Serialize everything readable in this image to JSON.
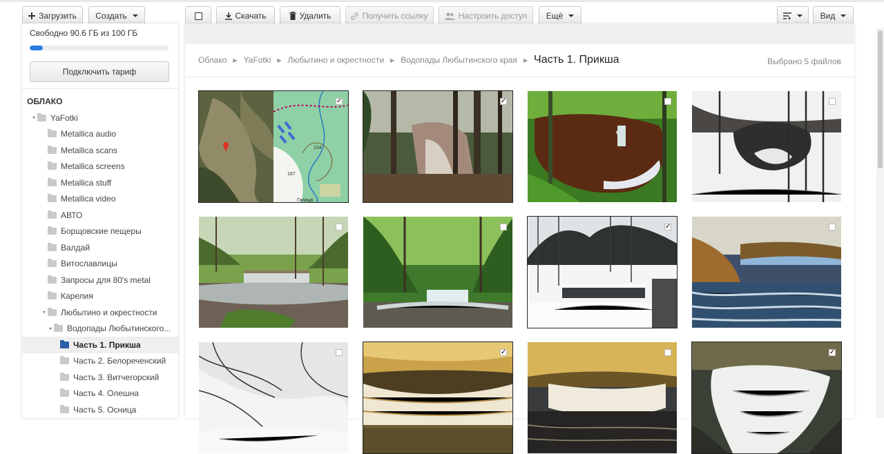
{
  "toolbar": {
    "upload": "Загрузить",
    "create": "Создать",
    "download": "Скачать",
    "delete": "Удалить",
    "get_link": "Получить ссылку",
    "share": "Настроить доступ",
    "more": "Ещё",
    "view": "Вид"
  },
  "sidebar": {
    "quota_text": "Свободно 90.6 ГБ из 100 ГБ",
    "quota_used": 0.094,
    "plan_button": "Подключить тариф",
    "section": "ОБЛАКО",
    "tree": [
      {
        "label": "YaFotki",
        "level": 0,
        "toggle": "▾"
      },
      {
        "label": "Metallica audio",
        "level": 1
      },
      {
        "label": "Metallica scans",
        "level": 1
      },
      {
        "label": "Metallica screens",
        "level": 1
      },
      {
        "label": "Metallica stuff",
        "level": 1
      },
      {
        "label": "Metallica video",
        "level": 1
      },
      {
        "label": "АВТО",
        "level": 1
      },
      {
        "label": "Борщовские пещеры",
        "level": 1
      },
      {
        "label": "Валдай",
        "level": 1
      },
      {
        "label": "Витославлицы",
        "level": 1
      },
      {
        "label": "Запросы для 80's metal",
        "level": 1
      },
      {
        "label": "Карелия",
        "level": 1
      },
      {
        "label": "Любытино и окрестности",
        "level": 1,
        "toggle": "▾"
      },
      {
        "label": "Водопады Любытинского...",
        "level": 2,
        "toggle": "▾"
      },
      {
        "label": "Часть 1. Прикша",
        "level": 3,
        "active": true
      },
      {
        "label": "Часть 2. Белореченский",
        "level": 3
      },
      {
        "label": "Часть 3. Витчегорский",
        "level": 3
      },
      {
        "label": "Часть 4. Олешна",
        "level": 3
      },
      {
        "label": "Часть 5. Осница",
        "level": 3
      }
    ]
  },
  "breadcrumbs": [
    "Облако",
    "YaFotki",
    "Любытино и окрестности",
    "Водопады Любытинского края"
  ],
  "current_folder": "Часть 1. Прикша",
  "selection_info": "Выбрано 5 файлов",
  "map_labels": {
    "hill1": "234",
    "hill2": "187",
    "village": "Галица"
  },
  "photos": [
    {
      "kind": "map",
      "selected": true
    },
    {
      "kind": "forest-rock",
      "selected": true
    },
    {
      "kind": "brown-pool",
      "selected": false
    },
    {
      "kind": "snow-cave",
      "selected": false
    },
    {
      "kind": "falls-spring",
      "selected": false
    },
    {
      "kind": "falls-green",
      "selected": false
    },
    {
      "kind": "falls-snow",
      "selected": true
    },
    {
      "kind": "river-autumn",
      "selected": false
    },
    {
      "kind": "snow-trees",
      "selected": false
    },
    {
      "kind": "falls-golden",
      "selected": true
    },
    {
      "kind": "river-golden",
      "selected": false
    },
    {
      "kind": "water-rush",
      "selected": true
    }
  ]
}
